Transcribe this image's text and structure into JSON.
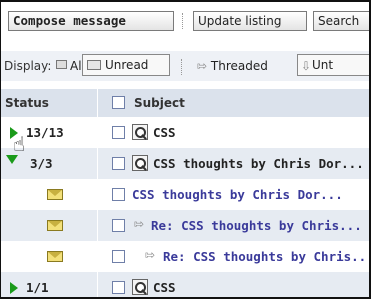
{
  "toolbar": {
    "compose_label": "Compose message",
    "update_label": "Update listing",
    "search_label": "Search"
  },
  "display": {
    "label": "Display:",
    "all_label": "All",
    "unread_label": "Unread",
    "threaded_label": "Threaded",
    "unthreaded_label": "Unt"
  },
  "table": {
    "headers": {
      "status": "Status",
      "subject": "Subject"
    },
    "rows": [
      {
        "count": "13/13",
        "subject": "CSS"
      },
      {
        "count": "3/3",
        "subject": "CSS thoughts by Chris Dor..."
      },
      {
        "subject": "CSS thoughts by Chris Dor..."
      },
      {
        "subject": "Re: CSS thoughts by Chris..."
      },
      {
        "subject": "Re: CSS thoughts by Chris..."
      },
      {
        "count": "1/1",
        "subject": "CSS"
      }
    ]
  },
  "colors": {
    "accent": "#1a9a1a",
    "link": "#3a3a9a",
    "header_bg": "#dbe2ec",
    "row_shade": "#e6ebf2"
  }
}
